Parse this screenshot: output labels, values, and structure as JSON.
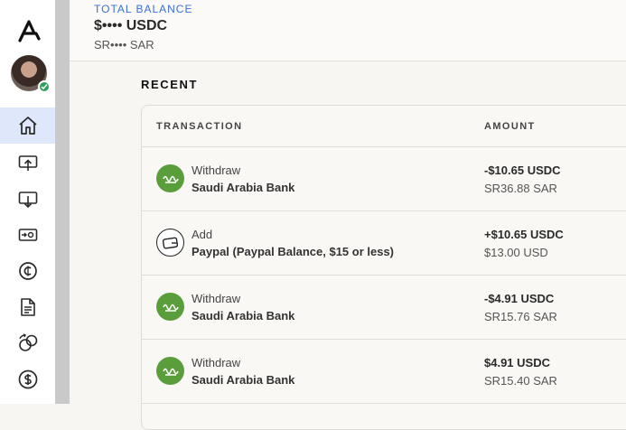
{
  "balance": {
    "label": "TOTAL BALANCE",
    "usdc": "$•••• USDC",
    "sar": "SR•••• SAR"
  },
  "recent": {
    "title": "RECENT",
    "headers": {
      "transaction": "TRANSACTION",
      "amount": "AMOUNT"
    },
    "rows": [
      {
        "type": "Withdraw",
        "name": "Saudi Arabia Bank",
        "amount": "-$10.65 USDC",
        "sub": "SR36.88 SAR",
        "icon": "bank-icon"
      },
      {
        "type": "Add",
        "name": "Paypal (Paypal Balance, $15 or less)",
        "amount": "+$10.65 USDC",
        "sub": "$13.00 USD",
        "icon": "wallet-icon"
      },
      {
        "type": "Withdraw",
        "name": "Saudi Arabia Bank",
        "amount": "-$4.91 USDC",
        "sub": "SR15.76 SAR",
        "icon": "bank-icon"
      },
      {
        "type": "Withdraw",
        "name": "Saudi Arabia Bank",
        "amount": "$4.91 USDC",
        "sub": "SR15.40 SAR",
        "icon": "bank-icon"
      }
    ]
  },
  "sidebar": {
    "items": [
      "home-icon",
      "send-icon",
      "receive-icon",
      "transfer-icon",
      "coin-icon",
      "document-icon",
      "exchange-icon",
      "dollar-icon"
    ]
  },
  "colors": {
    "accent": "#3b6fd8",
    "bank_green": "#5a9e3c",
    "active_nav": "#dfe8fb"
  }
}
